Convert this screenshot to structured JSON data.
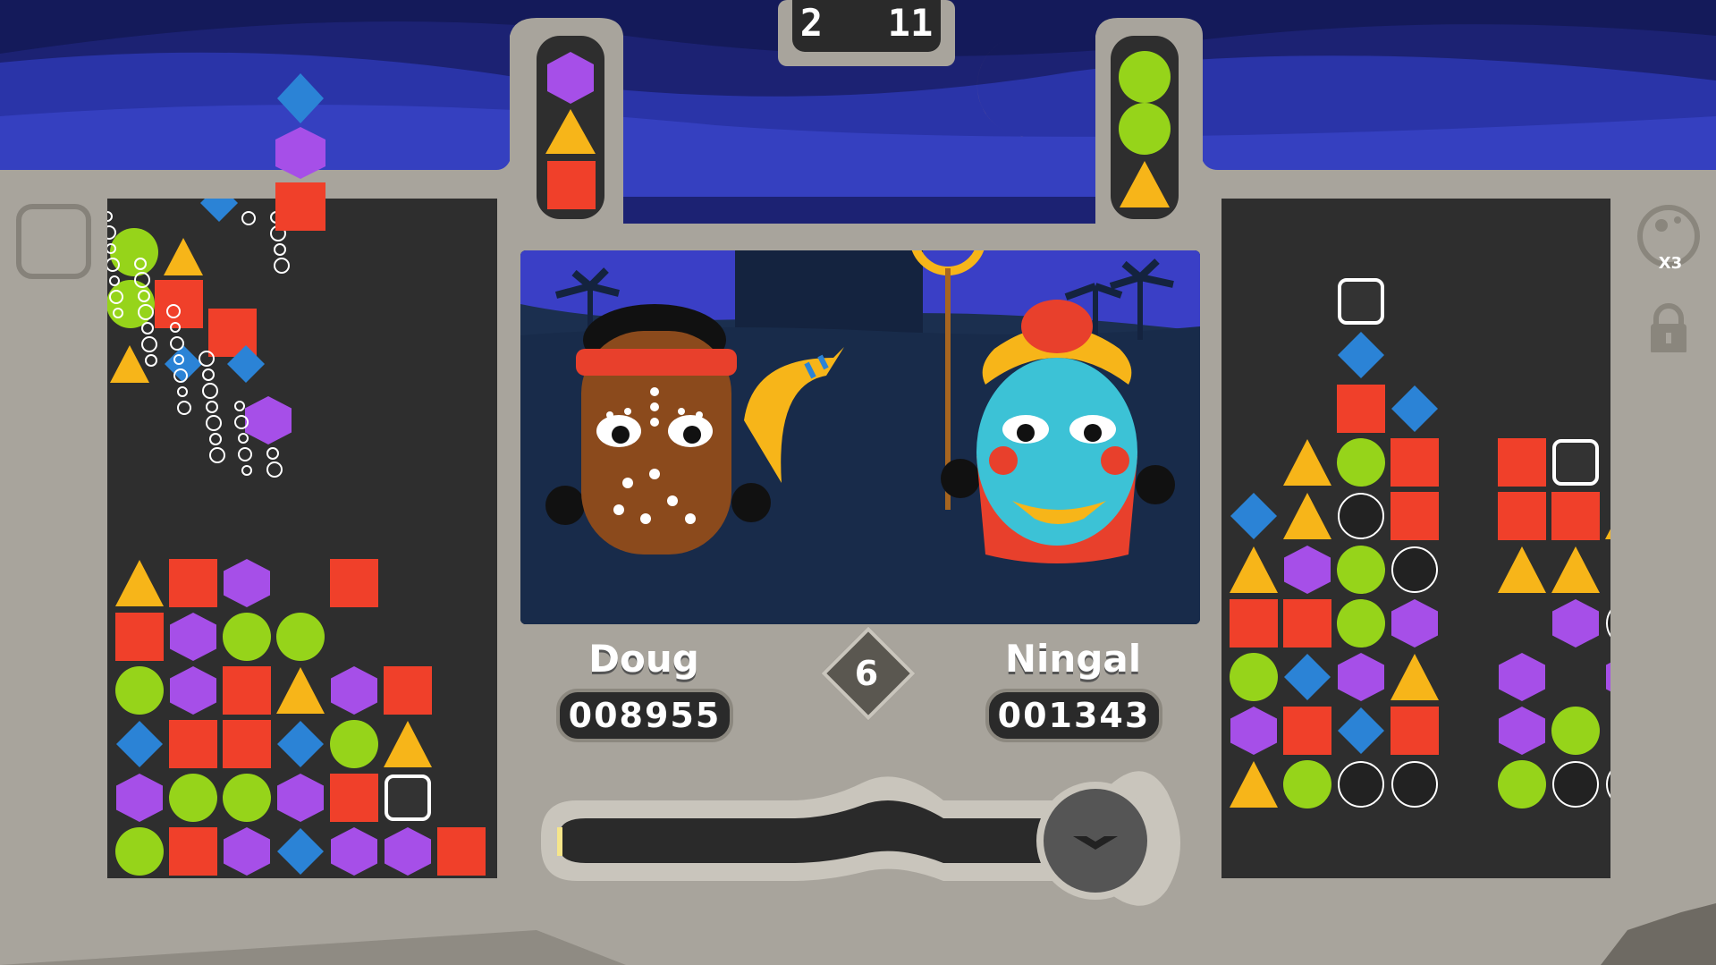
{
  "timer": {
    "minutes": "2",
    "seconds": "11"
  },
  "center_badge": "6",
  "player_left": {
    "name": "Doug",
    "score": "008955"
  },
  "player_right": {
    "name": "Ningal",
    "score": "001343"
  },
  "multiplier": "X3",
  "colors": {
    "red": "#f0402a",
    "purple": "#a64fe8",
    "green": "#96d41a",
    "yellow": "#f7b519",
    "blue": "#2b83d6",
    "frame": "#a8a49c",
    "well": "#2e2e2e"
  },
  "icons": {
    "moon": "crescent-moon-icon",
    "lock": "padlock-icon",
    "bubble": "bubble-icon",
    "hold": "hold-slot-icon"
  }
}
